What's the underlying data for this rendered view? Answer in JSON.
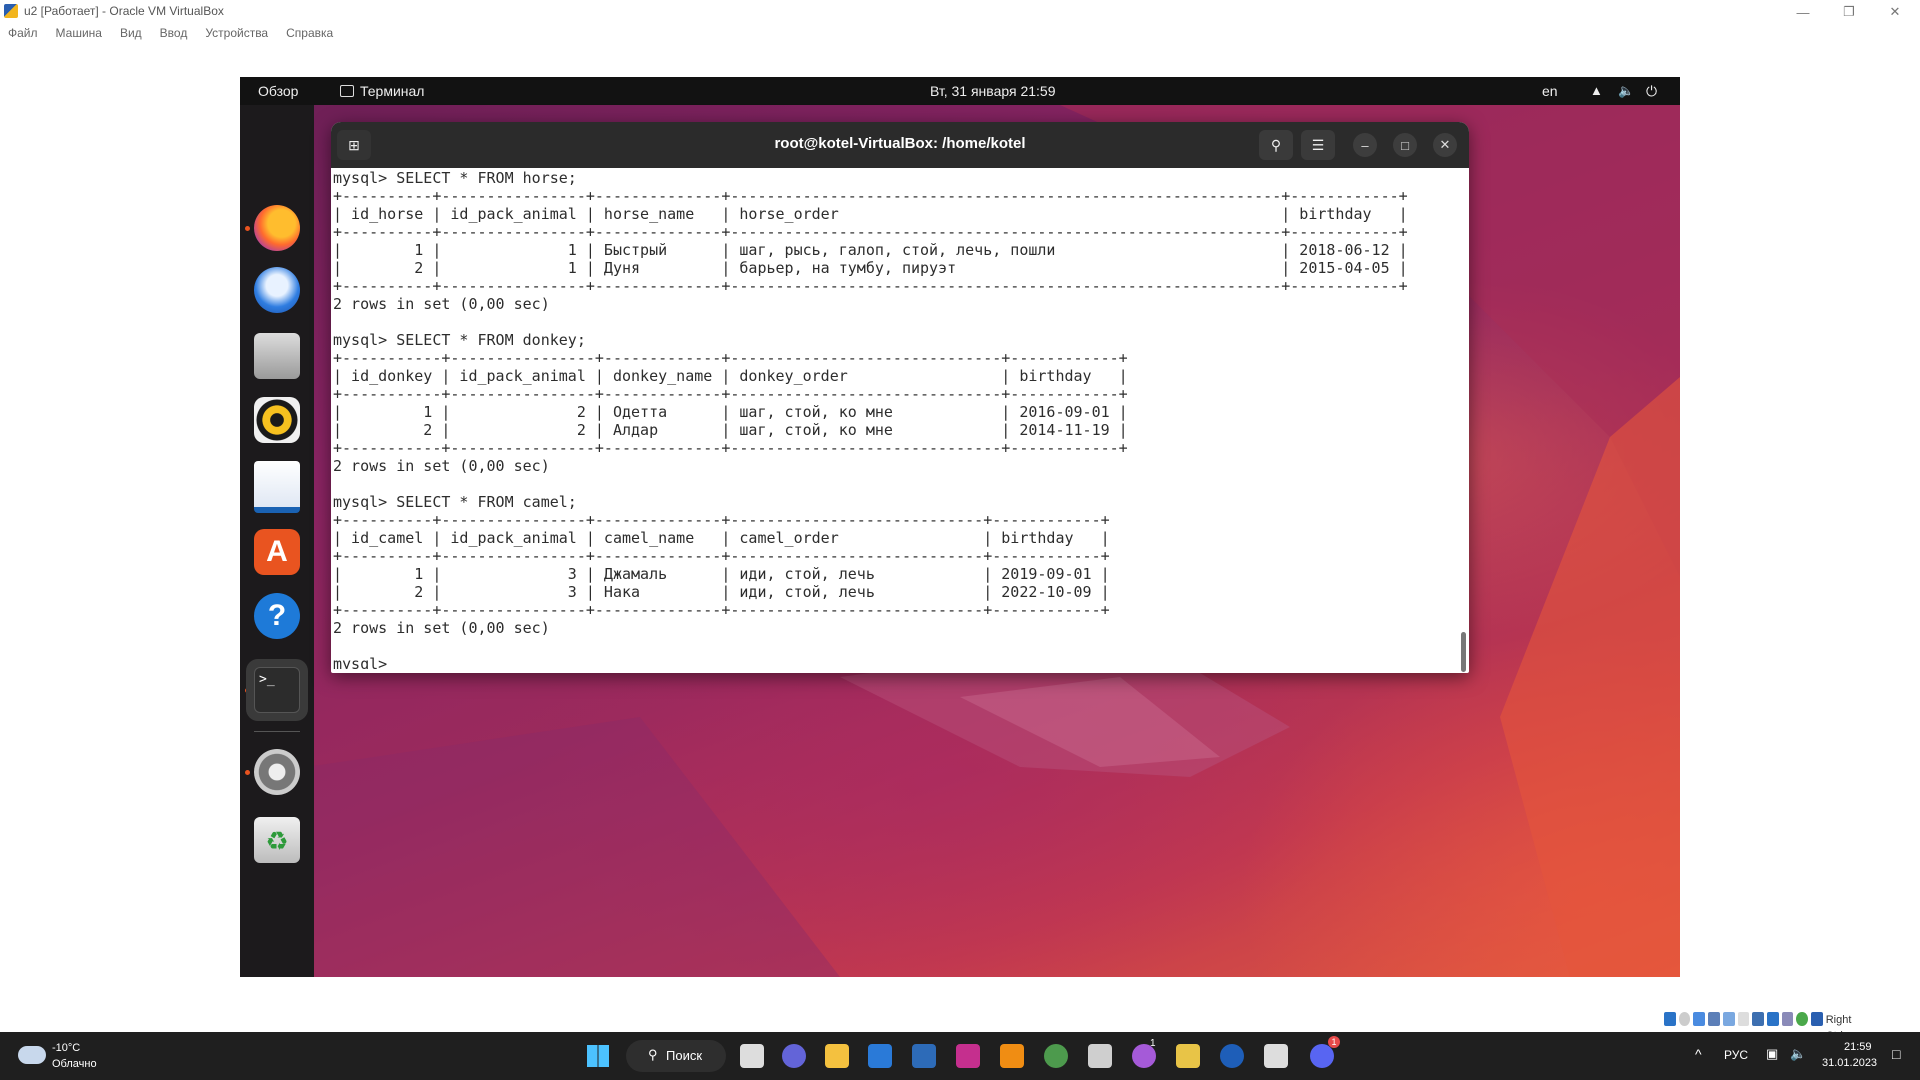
{
  "host": {
    "title": "u2 [Работает] - Oracle VM VirtualBox",
    "menu": [
      "Файл",
      "Машина",
      "Вид",
      "Ввод",
      "Устройства",
      "Справка"
    ],
    "controls": {
      "minimize": "—",
      "maximize": "❐",
      "close": "✕"
    },
    "host_key": "Right Ctrl"
  },
  "gnome": {
    "activities": "Обзор",
    "app_name": "Терминал",
    "clock": "Вт, 31 января  21:59",
    "lang": "en"
  },
  "dock": {
    "apps": [
      "firefox-icon",
      "thunderbird-icon",
      "files-icon",
      "rhythmbox-icon",
      "libreoffice-writer-icon",
      "app-center-icon",
      "help-icon",
      "terminal-icon",
      "settings-icon",
      "trash-icon"
    ],
    "show_apps": "show-apps-icon"
  },
  "terminal": {
    "title": "root@kotel-VirtualBox: /home/kotel",
    "lines": [
      "mysql> SELECT * FROM horse;",
      "+----------+----------------+--------------+-------------------------------------------------------------+------------+",
      "| id_horse | id_pack_animal | horse_name   | horse_order                                                 | birthday   |",
      "+----------+----------------+--------------+-------------------------------------------------------------+------------+",
      "|        1 |              1 | Быстрый      | шаг, рысь, галоп, стой, лечь, пошли                         | 2018-06-12 |",
      "|        2 |              1 | Дуня         | барьер, на тумбу, пируэт                                    | 2015-04-05 |",
      "+----------+----------------+--------------+-------------------------------------------------------------+------------+",
      "2 rows in set (0,00 sec)",
      "",
      "mysql> SELECT * FROM donkey;",
      "+-----------+----------------+-------------+------------------------------+------------+",
      "| id_donkey | id_pack_animal | donkey_name | donkey_order                 | birthday   |",
      "+-----------+----------------+-------------+------------------------------+------------+",
      "|         1 |              2 | Одетта      | шаг, стой, ко мне            | 2016-09-01 |",
      "|         2 |              2 | Алдар       | шаг, стой, ко мне            | 2014-11-19 |",
      "+-----------+----------------+-------------+------------------------------+------------+",
      "2 rows in set (0,00 sec)",
      "",
      "mysql> SELECT * FROM camel;",
      "+----------+----------------+--------------+----------------------------+------------+",
      "| id_camel | id_pack_animal | camel_name   | camel_order                | birthday   |",
      "+----------+----------------+--------------+----------------------------+------------+",
      "|        1 |              3 | Джамаль      | иди, стой, лечь            | 2019-09-01 |",
      "|        2 |              3 | Нака         | иди, стой, лечь            | 2022-10-09 |",
      "+----------+----------------+--------------+----------------------------+------------+",
      "2 rows in set (0,00 sec)",
      "",
      "mysql> "
    ]
  },
  "taskbar": {
    "weather_temp": "-10°C",
    "weather_desc": "Облачно",
    "search_label": "Поиск",
    "lang": "РУС",
    "time": "21:59",
    "date": "31.01.2023",
    "badge_1": "1",
    "badge_2": "1"
  },
  "colors": {
    "accent": "#e95420",
    "terminal_bg": "#ffffff",
    "header": "#2b2b2b",
    "taskbar": "#1f1f1f"
  }
}
